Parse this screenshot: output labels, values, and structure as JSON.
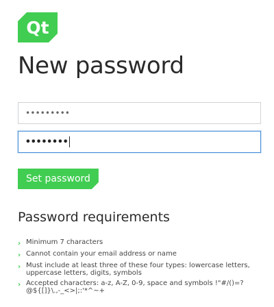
{
  "brand": {
    "logo_text": "Qt",
    "accent_color": "#41cd52"
  },
  "page": {
    "title": "New password"
  },
  "form": {
    "password_value": "•••••••••",
    "confirm_value": "••••••••",
    "set_password_label": "Set password"
  },
  "requirements": {
    "heading": "Password requirements",
    "items": [
      "Minimum 7 characters",
      "Cannot contain your email address or name",
      "Must include at least three of these four types: lowercase letters, uppercase letters, digits, symbols",
      "Accepted characters: a-z, A-Z, 0-9, space and symbols !\"#/()=?@${[]}\\.,-_<>|;:'*^~+"
    ],
    "bullet_icon": "chevron-right-icon"
  }
}
